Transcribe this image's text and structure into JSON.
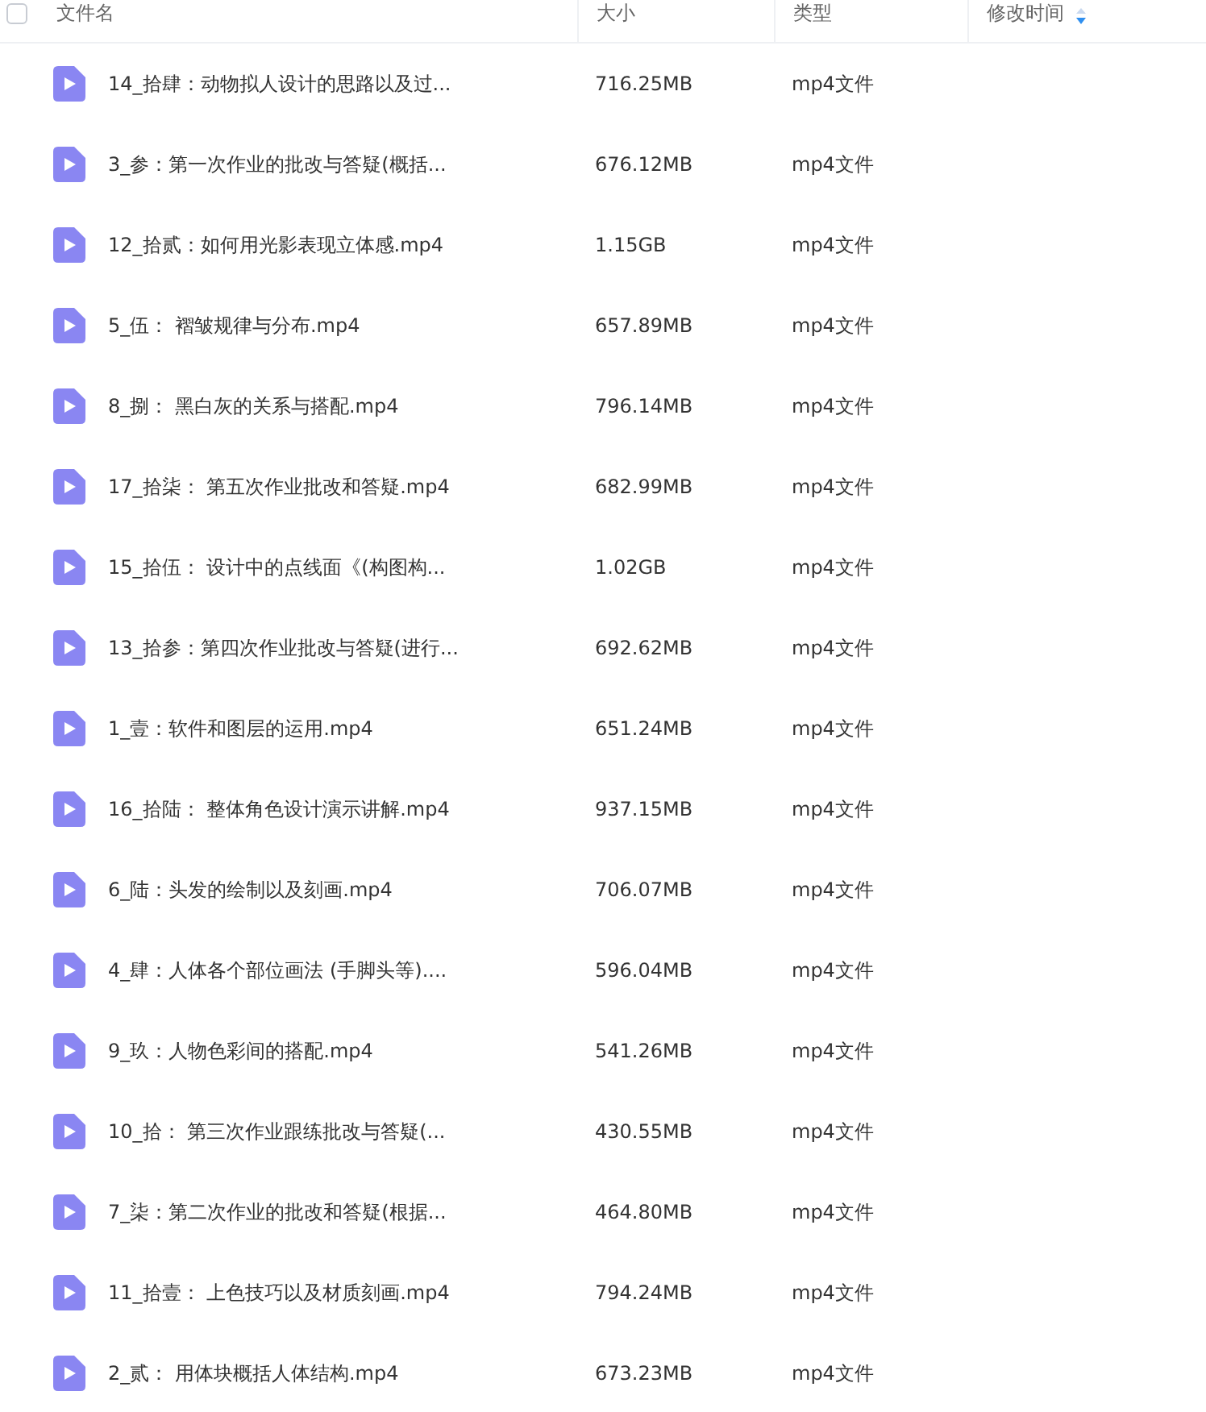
{
  "header": {
    "select_all": {
      "checked": false
    },
    "columns": [
      {
        "label": "文件名",
        "sorted": false
      },
      {
        "label": "大小",
        "sorted": false
      },
      {
        "label": "类型",
        "sorted": false
      },
      {
        "label": "修改时间",
        "sorted": true
      }
    ]
  },
  "rows": [
    {
      "name": "14_拾肆：动物拟人设计的思路以及过...",
      "size": "716.25MB",
      "type": "mp4文件"
    },
    {
      "name": "3_参：第一次作业的批改与答疑(概括...",
      "size": "676.12MB",
      "type": "mp4文件"
    },
    {
      "name": "12_拾贰：如何用光影表现立体感.mp4",
      "size": "1.15GB",
      "type": "mp4文件"
    },
    {
      "name": "5_伍： 褶皱规律与分布.mp4",
      "size": "657.89MB",
      "type": "mp4文件"
    },
    {
      "name": "8_捌： 黑白灰的关系与搭配.mp4",
      "size": "796.14MB",
      "type": "mp4文件"
    },
    {
      "name": "17_拾柒： 第五次作业批改和答疑.mp4",
      "size": "682.99MB",
      "type": "mp4文件"
    },
    {
      "name": "15_拾伍： 设计中的点线面《(构图构...",
      "size": "1.02GB",
      "type": "mp4文件"
    },
    {
      "name": "13_拾参：第四次作业批改与答疑(进行...",
      "size": "692.62MB",
      "type": "mp4文件"
    },
    {
      "name": "1_壹：软件和图层的运用.mp4",
      "size": "651.24MB",
      "type": "mp4文件"
    },
    {
      "name": "16_拾陆： 整体角色设计演示讲解.mp4",
      "size": "937.15MB",
      "type": "mp4文件"
    },
    {
      "name": "6_陆：头发的绘制以及刻画.mp4",
      "size": "706.07MB",
      "type": "mp4文件"
    },
    {
      "name": "4_肆：人体各个部位画法 (手脚头等)....",
      "size": "596.04MB",
      "type": "mp4文件"
    },
    {
      "name": "9_玖：人物色彩间的搭配.mp4",
      "size": "541.26MB",
      "type": "mp4文件"
    },
    {
      "name": "10_拾： 第三次作业跟练批改与答疑(...",
      "size": "430.55MB",
      "type": "mp4文件"
    },
    {
      "name": "7_柒：第二次作业的批改和答疑(根据...",
      "size": "464.80MB",
      "type": "mp4文件"
    },
    {
      "name": "11_拾壹： 上色技巧以及材质刻画.mp4",
      "size": "794.24MB",
      "type": "mp4文件"
    },
    {
      "name": "2_贰： 用体块概括人体结构.mp4",
      "size": "673.23MB",
      "type": "mp4文件"
    }
  ]
}
